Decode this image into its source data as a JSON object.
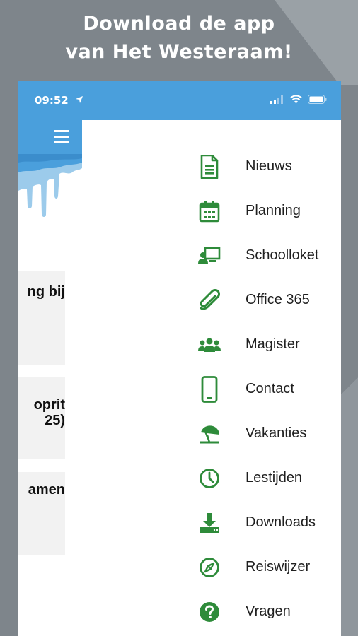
{
  "headline": {
    "line1": "Download de app",
    "line2": "van Het Westeraam!"
  },
  "status_bar": {
    "time": "09:52"
  },
  "colors": {
    "accent": "#4a9fdc",
    "icon_green": "#2e8b3a",
    "background": "#7e858b"
  },
  "underlying_cards": [
    {
      "text_lines": [
        "ng bij"
      ]
    },
    {
      "text_lines": [
        "oprit",
        "25)"
      ]
    },
    {
      "text_lines": [
        "amen"
      ]
    }
  ],
  "menu": {
    "items": [
      {
        "label": "Nieuws",
        "icon": "document-icon"
      },
      {
        "label": "Planning",
        "icon": "calendar-icon"
      },
      {
        "label": "Schoolloket",
        "icon": "teacher-board-icon"
      },
      {
        "label": "Office 365",
        "icon": "paperclip-icon"
      },
      {
        "label": "Magister",
        "icon": "users-icon"
      },
      {
        "label": "Contact",
        "icon": "mobile-phone-icon"
      },
      {
        "label": "Vakanties",
        "icon": "beach-umbrella-icon"
      },
      {
        "label": "Lestijden",
        "icon": "clock-icon"
      },
      {
        "label": "Downloads",
        "icon": "download-icon"
      },
      {
        "label": "Reiswijzer",
        "icon": "compass-icon"
      },
      {
        "label": "Vragen",
        "icon": "question-icon"
      }
    ]
  }
}
